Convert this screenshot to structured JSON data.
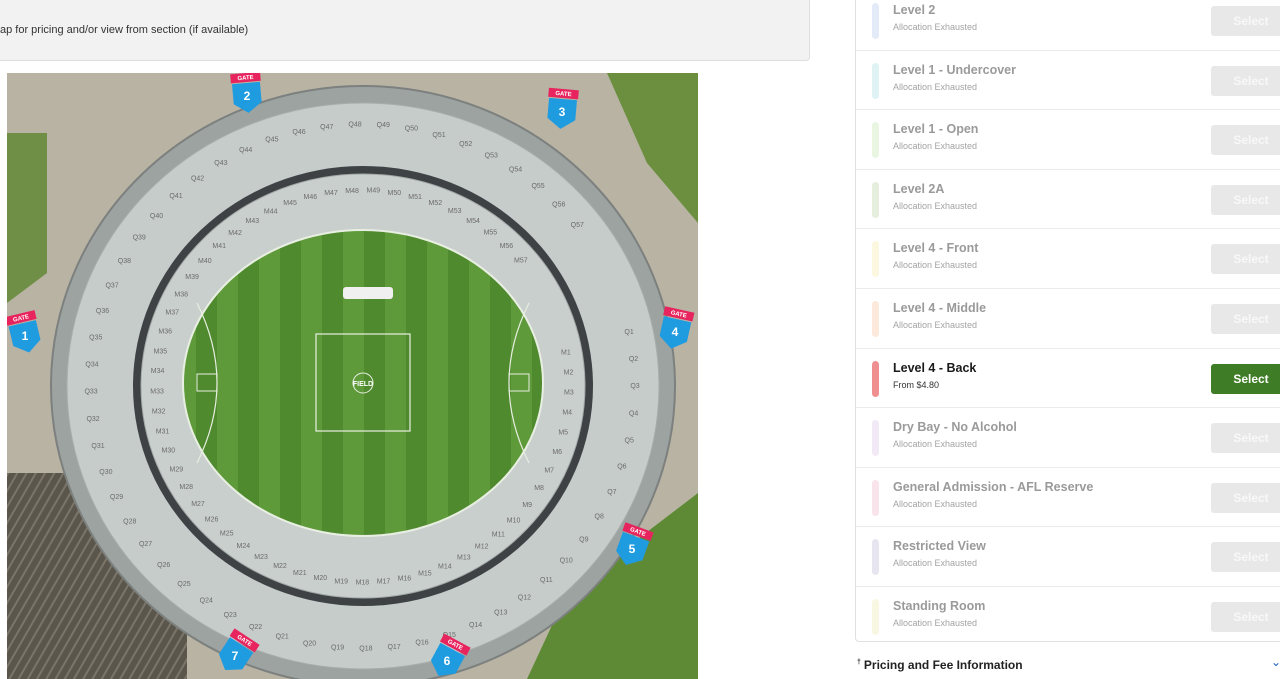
{
  "hint": {
    "text": "ap for pricing and/or view from section (if available)"
  },
  "map": {
    "field_label": "FIELD",
    "gates": [
      {
        "number": "1",
        "label": "GATE"
      },
      {
        "number": "2",
        "label": "GATE"
      },
      {
        "number": "3",
        "label": "GATE"
      },
      {
        "number": "4",
        "label": "GATE"
      },
      {
        "number": "5",
        "label": "GATE"
      },
      {
        "number": "6",
        "label": "GATE"
      },
      {
        "number": "7",
        "label": "GATE"
      }
    ],
    "outer_sections": [
      "Q1",
      "Q2",
      "Q3",
      "Q4",
      "Q5",
      "Q6",
      "Q7",
      "Q8",
      "Q9",
      "Q10",
      "Q11",
      "Q12",
      "Q13",
      "Q14",
      "Q15",
      "Q16",
      "Q17",
      "Q18",
      "Q19",
      "Q20",
      "Q21",
      "Q22",
      "Q23",
      "Q24",
      "Q25",
      "Q26",
      "Q27",
      "Q28",
      "Q29",
      "Q30",
      "Q31",
      "Q32",
      "Q33",
      "Q34",
      "Q35",
      "Q36",
      "Q37",
      "Q38",
      "Q39",
      "Q40",
      "Q41",
      "Q42",
      "Q43",
      "Q44",
      "Q45",
      "Q46",
      "Q47",
      "Q48",
      "Q49",
      "Q50",
      "Q51",
      "Q52",
      "Q53",
      "Q54",
      "Q55",
      "Q56",
      "Q57"
    ],
    "inner_sections": [
      "M1",
      "M2",
      "M3",
      "M4",
      "M5",
      "M6",
      "M7",
      "M8",
      "M9",
      "M10",
      "M11",
      "M12",
      "M13",
      "M14",
      "M15",
      "M16",
      "M17",
      "M18",
      "M19",
      "M20",
      "M21",
      "M22",
      "M23",
      "M24",
      "M25",
      "M26",
      "M27",
      "M28",
      "M29",
      "M30",
      "M31",
      "M32",
      "M33",
      "M34",
      "M35",
      "M36",
      "M37",
      "M38",
      "M39",
      "M40",
      "M41",
      "M42",
      "M43",
      "M44",
      "M45",
      "M46",
      "M47",
      "M48",
      "M49",
      "M50",
      "M51",
      "M52",
      "M53",
      "M54",
      "M55",
      "M56",
      "M57"
    ]
  },
  "allocations": [
    {
      "name": "Level 2",
      "status": "Allocation Exhausted",
      "button": "Select",
      "color": "#e3ebf8",
      "active": false
    },
    {
      "name": "Level 1 - Undercover",
      "status": "Allocation Exhausted",
      "button": "Select",
      "color": "#dff3f5",
      "active": false
    },
    {
      "name": "Level 1 - Open",
      "status": "Allocation Exhausted",
      "button": "Select",
      "color": "#eaf6e1",
      "active": false
    },
    {
      "name": "Level 2A",
      "status": "Allocation Exhausted",
      "button": "Select",
      "color": "#e6eede",
      "active": false
    },
    {
      "name": "Level 4 - Front",
      "status": "Allocation Exhausted",
      "button": "Select",
      "color": "#fbf8df",
      "active": false
    },
    {
      "name": "Level 4 - Middle",
      "status": "Allocation Exhausted",
      "button": "Select",
      "color": "#fde8dc",
      "active": false
    },
    {
      "name": "Level 4 - Back",
      "status": "From $4.80",
      "button": "Select",
      "color": "#ef8f8f",
      "active": true
    },
    {
      "name": "Dry Bay - No Alcohol",
      "status": "Allocation Exhausted",
      "button": "Select",
      "color": "#f1eaf6",
      "active": false
    },
    {
      "name": "General Admission - AFL Reserve",
      "status": "Allocation Exhausted",
      "button": "Select",
      "color": "#f8e4ea",
      "active": false
    },
    {
      "name": "Restricted View",
      "status": "Allocation Exhausted",
      "button": "Select",
      "color": "#e7e6f0",
      "active": false
    },
    {
      "name": "Standing Room",
      "status": "Allocation Exhausted",
      "button": "Select",
      "color": "#f8f8e2",
      "active": false
    }
  ],
  "footer": {
    "dagger": "†",
    "pricing_label": "Pricing and Fee Information",
    "chevron": "chevron-down-icon"
  }
}
